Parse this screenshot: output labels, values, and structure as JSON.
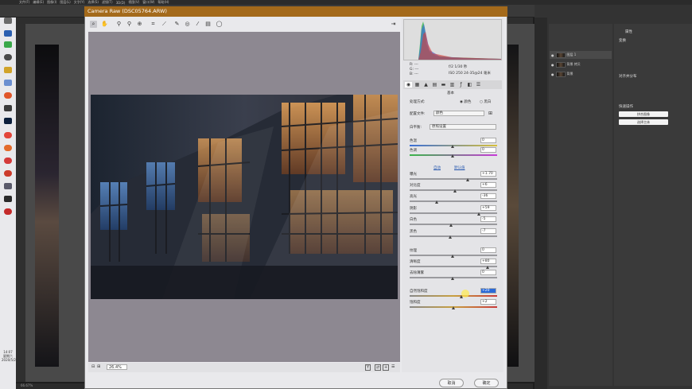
{
  "ps": {
    "menu": [
      "文件(F)",
      "编辑(E)",
      "图像(I)",
      "图层(L)",
      "文字(Y)",
      "选择(S)",
      "滤镜(T)",
      "3D(D)",
      "视图(V)",
      "窗口(W)",
      "帮助(H)"
    ],
    "statusbar": "66.67%",
    "layers": [
      {
        "name": "图层 1"
      },
      {
        "name": "背景 拷贝"
      },
      {
        "name": "背景"
      }
    ],
    "props_title": "属性",
    "transform_title": "变换",
    "align_title": "对齐并分布",
    "quick_actions_title": "快速操作",
    "btn_flatten": "拼合图像",
    "btn_select_subject": "选择主体"
  },
  "taskbar": {
    "time": "14:07",
    "weekday": "星期六",
    "date": "2020/5/2"
  },
  "cr": {
    "title": "Camera Raw (DSC05764.ARW)",
    "info": {
      "r": "R: ---",
      "g": "G: ---",
      "b": "B: ---",
      "aperture": "f/2  1/30 秒",
      "iso": "ISO 250  24-35@24 毫米"
    },
    "panel_title": "基本",
    "treatment_label": "处理方式:",
    "treatment_color": "颜色",
    "treatment_bw": "黑白",
    "profile_label": "配置文件:",
    "profile_value": "颜色",
    "wb_label": "白平衡:",
    "wb_value": "原照设置",
    "auto_label": "自动",
    "default_label": "默认值",
    "sliders": [
      {
        "label": "色温",
        "value": "0",
        "pos": 0.5
      },
      {
        "label": "色调",
        "value": "0",
        "pos": 0.5
      },
      {
        "label": "曝光",
        "value": "+1.70",
        "pos": 0.67
      },
      {
        "label": "对比度",
        "value": "+6",
        "pos": 0.53
      },
      {
        "label": "高光",
        "value": "-36",
        "pos": 0.32
      },
      {
        "label": "阴影",
        "value": "+59",
        "pos": 0.8
      },
      {
        "label": "白色",
        "value": "-5",
        "pos": 0.48
      },
      {
        "label": "黑色",
        "value": "-7",
        "pos": 0.47
      },
      {
        "label": "纹理",
        "value": "0",
        "pos": 0.5
      },
      {
        "label": "清晰度",
        "value": "+80",
        "pos": 0.9
      },
      {
        "label": "去除薄雾",
        "value": "0",
        "pos": 0.5
      },
      {
        "label": "自然饱和度",
        "value": "+20",
        "pos": 0.6
      },
      {
        "label": "饱和度",
        "value": "+2",
        "pos": 0.51
      }
    ],
    "zoom": "26.4%",
    "cancel": "取消",
    "ok": "确定"
  }
}
